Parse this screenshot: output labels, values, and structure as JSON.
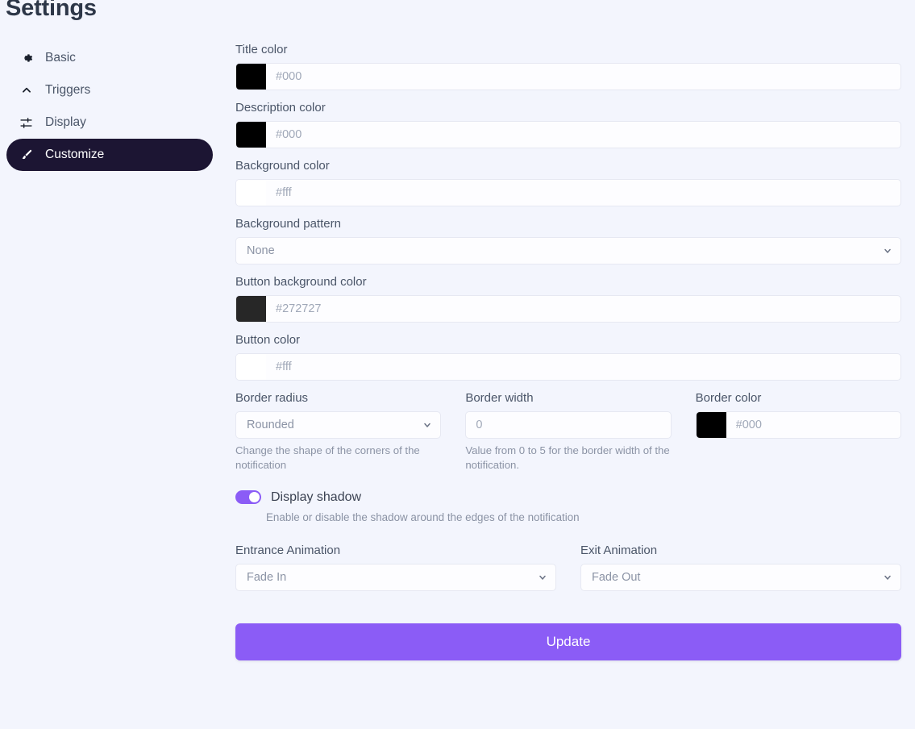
{
  "page": {
    "title": "Settings",
    "background_color": "#f3f5fd",
    "accent_color": "#8b5cf6",
    "active_nav_color": "#1c1533"
  },
  "sidebar": {
    "items": [
      {
        "label": "Basic",
        "icon": "gear-icon",
        "active": false
      },
      {
        "label": "Triggers",
        "icon": "chevron-up-icon",
        "active": false
      },
      {
        "label": "Display",
        "icon": "sliders-icon",
        "active": false
      },
      {
        "label": "Customize",
        "icon": "paintbrush-icon",
        "active": true
      }
    ]
  },
  "form": {
    "title_color": {
      "label": "Title color",
      "value": "",
      "placeholder": "#000",
      "swatch": "#000000"
    },
    "description_color": {
      "label": "Description color",
      "value": "",
      "placeholder": "#000",
      "swatch": "#000000"
    },
    "background_color": {
      "label": "Background color",
      "value": "",
      "placeholder": "#fff",
      "swatch": "#ffffff"
    },
    "background_pattern": {
      "label": "Background pattern",
      "value": "None",
      "options": [
        "None"
      ]
    },
    "button_background_color": {
      "label": "Button background color",
      "value": "",
      "placeholder": "#272727",
      "swatch": "#272727"
    },
    "button_color": {
      "label": "Button color",
      "value": "",
      "placeholder": "#fff",
      "swatch": "#ffffff"
    },
    "border_radius": {
      "label": "Border radius",
      "value": "Rounded",
      "options": [
        "Rounded"
      ],
      "helper": "Change the shape of the corners of the notification"
    },
    "border_width": {
      "label": "Border width",
      "value": "",
      "placeholder": "0",
      "helper": "Value from 0 to 5 for the border width of the notification."
    },
    "border_color": {
      "label": "Border color",
      "value": "",
      "placeholder": "#000",
      "swatch": "#000000"
    },
    "display_shadow": {
      "label": "Display shadow",
      "enabled": true,
      "helper": "Enable or disable the shadow around the edges of the notification"
    },
    "entrance_animation": {
      "label": "Entrance Animation",
      "value": "Fade In",
      "options": [
        "Fade In"
      ]
    },
    "exit_animation": {
      "label": "Exit Animation",
      "value": "Fade Out",
      "options": [
        "Fade Out"
      ]
    },
    "submit": {
      "label": "Update"
    }
  }
}
